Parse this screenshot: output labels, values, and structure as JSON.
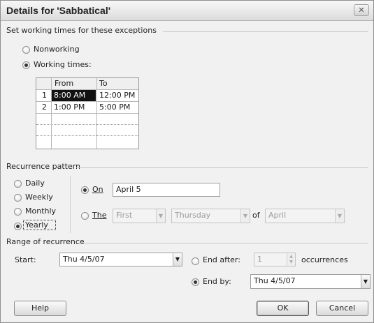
{
  "dialog": {
    "title": "Details for 'Sabbatical'",
    "close_glyph": "✕"
  },
  "exceptions": {
    "heading": "Set working times for these exceptions",
    "nonworking_label": "Nonworking",
    "working_times_label": "Working times:",
    "selected": "Working times:",
    "table": {
      "headers": [
        "From",
        "To"
      ],
      "rows": [
        {
          "num": "1",
          "from": "8:00 AM",
          "to": "12:00 PM"
        },
        {
          "num": "2",
          "from": "1:00 PM",
          "to": "5:00 PM"
        }
      ]
    }
  },
  "recurrence": {
    "heading": "Recurrence pattern",
    "options": [
      "Daily",
      "Weekly",
      "Monthly",
      "Yearly"
    ],
    "selected": "Yearly",
    "on_label": "On",
    "on_value": "April 5",
    "the_label": "The",
    "the_ordinal": "First",
    "the_weekday": "Thursday",
    "of_label": "of",
    "the_month": "April"
  },
  "range": {
    "heading": "Range of recurrence",
    "start_label": "Start:",
    "start_value": "Thu 4/5/07",
    "end_after_label": "End after:",
    "occurrences_value": "1",
    "occurrences_label": "occurrences",
    "end_by_label": "End by:",
    "end_by_value": "Thu 4/5/07",
    "selected": "End by:"
  },
  "buttons": {
    "help": "Help",
    "ok": "OK",
    "cancel": "Cancel"
  },
  "icons": {
    "dropdown": "▼",
    "spin_up": "▲",
    "spin_down": "▼"
  }
}
